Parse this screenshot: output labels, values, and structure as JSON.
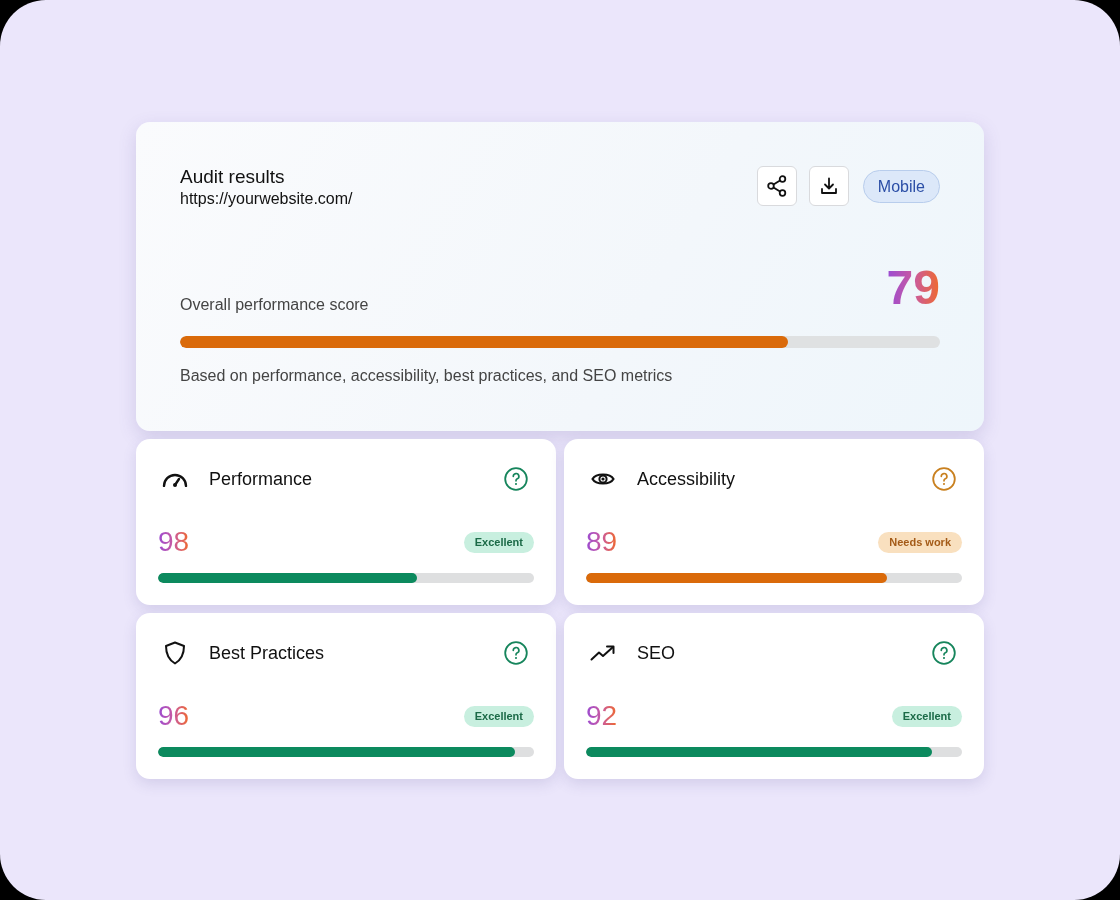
{
  "summary": {
    "title": "Audit results",
    "url": "https://yourwebsite.com/",
    "device": "Mobile",
    "score_label": "Overall performance score",
    "score": "79",
    "warning": true,
    "level": 0.8,
    "note": "Based on performance, accessibility, best practices, and SEO metrics"
  },
  "categories": [
    {
      "title": "Performance",
      "score": "98",
      "badge": "Excellent",
      "warning": false,
      "level": 0.69
    },
    {
      "title": "Accessibility",
      "score": "89",
      "badge": "Needs work",
      "warning": true,
      "level": 0.8
    },
    {
      "title": "Best Practices",
      "score": "96",
      "badge": "Excellent",
      "warning": false,
      "level": 0.95
    },
    {
      "title": "SEO",
      "score": "92",
      "badge": "Excellent",
      "warning": false,
      "level": 0.92
    }
  ]
}
